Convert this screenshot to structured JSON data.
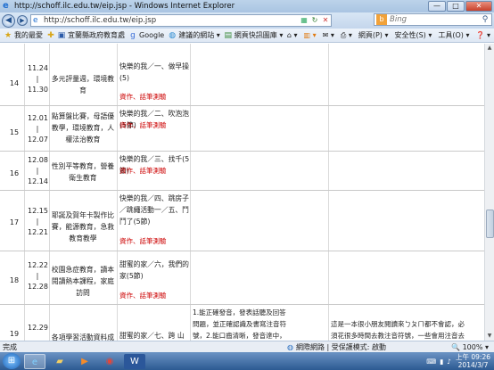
{
  "window": {
    "title": "http://schoff.ilc.edu.tw/eip.jsp - Windows Internet Explorer",
    "buttons": {
      "minimize": "—",
      "maximize": "□",
      "close": "✕"
    }
  },
  "address": {
    "url": "http://schoff.ilc.edu.tw/eip.jsp",
    "search_placeholder": "Bing"
  },
  "favorites": {
    "favorites_label": "我的最愛",
    "items": [
      "宜蘭縣政府教育處",
      "Google",
      "建議的網站 ▾",
      "網頁快訊圖庫 ▾"
    ]
  },
  "commands": [
    "網頁(P) ▾",
    "安全性(S) ▾",
    "工具(O) ▾",
    "❓ ▾"
  ],
  "rows": [
    {
      "num": "14",
      "date_start": "11.24",
      "date_end": "11.30",
      "topic": "多元評量週，環境教育",
      "lesson": "快樂的我／一、做早操(5)",
      "link": "資作、話筆測驗",
      "col4": "",
      "col5": ""
    },
    {
      "num": "15",
      "date_start": "12.01",
      "date_end": "12.07",
      "topic": "點算盤比賽，母語優教學，環境教育，人權法治教育",
      "lesson": "快樂的我／二、吹泡泡(5節)",
      "link": "資作、話筆測驗",
      "col4": "",
      "col5": ""
    },
    {
      "num": "16",
      "date_start": "12.08",
      "date_end": "12.14",
      "topic": "性別平等教育，營養衛生教育",
      "lesson": "快樂的我／三、找千(5節)",
      "link": "資作、話筆測驗",
      "col4": "",
      "col5": ""
    },
    {
      "num": "17",
      "date_start": "12.15",
      "date_end": "12.21",
      "topic": "耶誕及賀年卡製作比賽，能源教育，急救教育教學",
      "lesson": "快樂的我／四、跳房子／跳繩活動一／五、鬥鬥了(5節)",
      "link": "資作、話筆測驗",
      "col4": "",
      "col5": ""
    },
    {
      "num": "18",
      "date_start": "12.22",
      "date_end": "12.28",
      "topic": "校園急症教育，讀本閱讀熱本課程，家庭訪問",
      "lesson": "甜蜜的家／六，我們的家(5節)",
      "link": "資作、話筆測驗",
      "col4": "",
      "col5": ""
    },
    {
      "num": "19",
      "date_start": "12.29",
      "date_end": "",
      "topic": "各項學習活動資料成果發",
      "lesson": "甜蜜的家／七、跨 山(5節)",
      "link": "",
      "col4": "1.能正確發音，發表話聽及回答問題，並正確認識及書寫注音符號，2.能口齒清晰，發音達中，發表自己和",
      "col5": "這是一本很小朋友閱讀來ㄅㄆㄇ都不會認，必須花很多時間去教注音符號，一些會用注音去閱讀..."
    }
  ],
  "status": {
    "left": "完成",
    "zone": "網際網路 | 受保護模式: 啟動",
    "zoom": "🔍 100% ▾"
  },
  "taskbar": {
    "time": "上午 09:26",
    "date": "2014/3/7"
  }
}
